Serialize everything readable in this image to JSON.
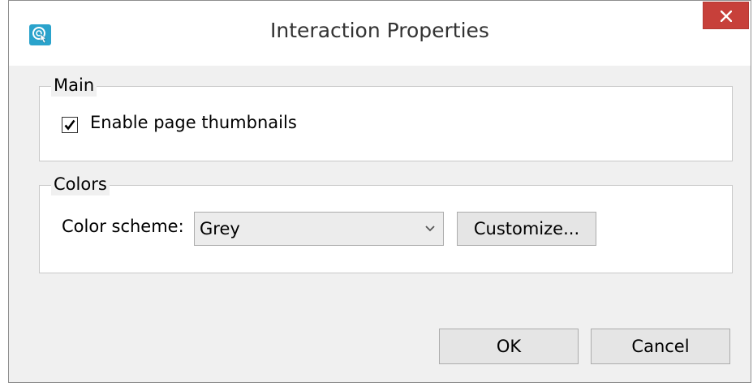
{
  "window": {
    "title": "Interaction Properties",
    "icon": "touch-pointer-icon",
    "accent_color": "#2aa3cc",
    "close_color": "#c7403a"
  },
  "main_group": {
    "legend": "Main",
    "enable_thumbnails": {
      "label": "Enable page thumbnails",
      "checked": true
    }
  },
  "colors_group": {
    "legend": "Colors",
    "color_scheme": {
      "label": "Color scheme:",
      "value": "Grey"
    },
    "customize_label": "Customize..."
  },
  "buttons": {
    "ok_label": "OK",
    "cancel_label": "Cancel"
  }
}
